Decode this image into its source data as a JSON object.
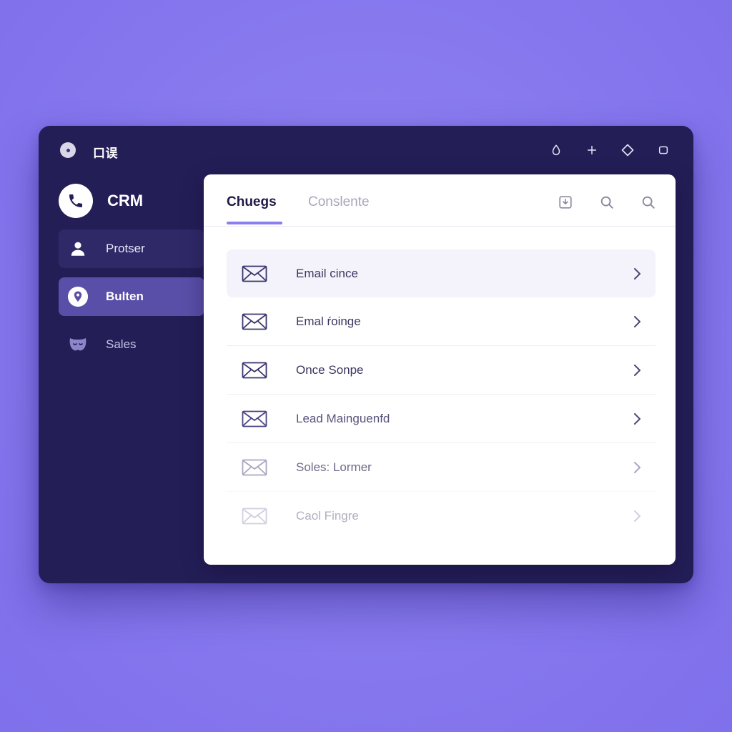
{
  "window": {
    "title": "口误",
    "controls": [
      {
        "icon": "droplet-icon"
      },
      {
        "icon": "plus-icon"
      },
      {
        "icon": "diamond-icon"
      },
      {
        "icon": "square-icon"
      }
    ]
  },
  "sidebar": {
    "brand": "CRM",
    "items": [
      {
        "label": "Protser",
        "icon": "user-icon"
      },
      {
        "label": "Bulten",
        "icon": "location-pin-icon",
        "active": true
      },
      {
        "label": "Sales",
        "icon": "mask-icon"
      }
    ]
  },
  "panel": {
    "tabs": [
      {
        "label": "Chuegs",
        "active": true
      },
      {
        "label": "Conslente",
        "active": false
      }
    ],
    "tools": [
      "download-icon",
      "search-icon",
      "search-icon"
    ],
    "rows": [
      {
        "label": "Email cince"
      },
      {
        "label": "Emal ŕoinge"
      },
      {
        "label": "Once Sonpe"
      },
      {
        "label": "Lead Mainguenfd"
      },
      {
        "label": "Soles: Lormer"
      },
      {
        "label": "Caol Fingre"
      }
    ]
  },
  "colors": {
    "background": "#8b7ef0",
    "window": "#241e57",
    "accent": "#8a7df0",
    "active_nav": "#5a4fa8",
    "text_dark": "#1e1a45"
  }
}
